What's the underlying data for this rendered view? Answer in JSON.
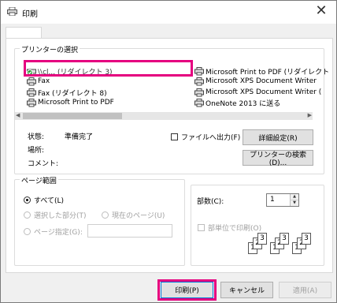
{
  "window": {
    "title": "印刷",
    "close_glyph": "✕"
  },
  "printer_group": {
    "label": "プリンターの選択"
  },
  "printers": [
    {
      "name": "\\\\cl... (リダイレクト 3)",
      "selected": true
    },
    {
      "name": "Fax",
      "selected": false
    },
    {
      "name": "Fax (リダイレクト 8)",
      "selected": false
    },
    {
      "name": "Microsoft Print to PDF",
      "selected": false
    },
    {
      "name": "Microsoft Print to PDF (リダイレクト",
      "selected": false
    },
    {
      "name": "Microsoft XPS Document Writer",
      "selected": false
    },
    {
      "name": "Microsoft XPS Document Writer (",
      "selected": false
    },
    {
      "name": "OneNote 2013 に送る",
      "selected": false
    }
  ],
  "status": {
    "state_label": "状態:",
    "state_value": "準備完了",
    "location_label": "場所:",
    "comment_label": "コメント:"
  },
  "print_to_file": {
    "label": "ファイルへ出力(F)",
    "checked": false
  },
  "buttons": {
    "details": "詳細設定(R)",
    "find_printer": "プリンターの検索(D)...",
    "print": "印刷(P)",
    "cancel": "キャンセル",
    "apply": "適用(A)"
  },
  "page_range": {
    "label": "ページ範囲",
    "all": "すべて(L)",
    "selection": "選択した部分(T)",
    "current_page": "現在のページ(U)",
    "pages": "ページ指定(G):",
    "selected": "all"
  },
  "copies": {
    "label": "部数(C):",
    "value": "1",
    "collate_label": "部単位で印刷(O)",
    "collate_checked": false
  },
  "colors": {
    "accent_highlight": "#e5007f"
  }
}
